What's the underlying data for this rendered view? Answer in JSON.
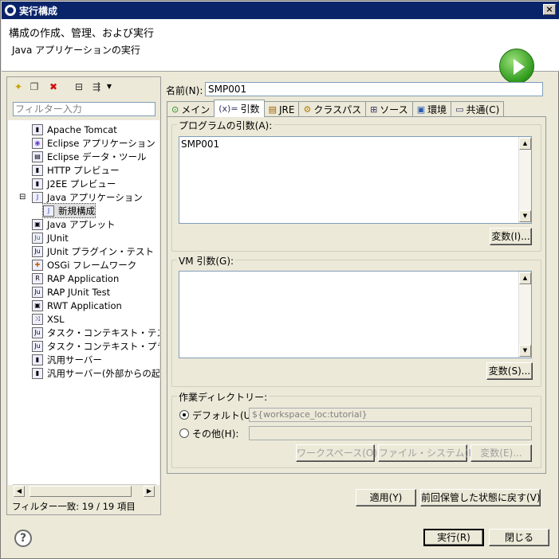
{
  "window": {
    "title": "実行構成",
    "close_glyph": "×"
  },
  "header": {
    "title": "構成の作成、管理、および実行",
    "subtitle": "Java アプリケーションの実行"
  },
  "left": {
    "filter_placeholder": "フィルター入力",
    "tree": [
      {
        "label": "Apache Tomcat",
        "icon": "tomcat-icon"
      },
      {
        "label": "Eclipse アプリケーション",
        "icon": "eclipse-icon"
      },
      {
        "label": "Eclipse データ・ツール",
        "icon": "database-icon"
      },
      {
        "label": "HTTP プレビュー",
        "icon": "server-icon"
      },
      {
        "label": "J2EE プレビュー",
        "icon": "server-icon"
      },
      {
        "label": "Java アプリケーション",
        "icon": "java-app-icon"
      },
      {
        "label": "新規構成",
        "icon": "java-app-icon"
      },
      {
        "label": "Java アプレット",
        "icon": "applet-icon"
      },
      {
        "label": "JUnit",
        "icon": "junit-icon"
      },
      {
        "label": "JUnit プラグイン・テスト",
        "icon": "junit-plugin-icon"
      },
      {
        "label": "OSGi フレームワーク",
        "icon": "osgi-icon"
      },
      {
        "label": "RAP Application",
        "icon": "rap-icon"
      },
      {
        "label": "RAP JUnit Test",
        "icon": "rap-junit-icon"
      },
      {
        "label": "RWT Application",
        "icon": "rwt-icon"
      },
      {
        "label": "XSL",
        "icon": "xsl-icon"
      },
      {
        "label": "タスク・コンテキスト・テスト",
        "icon": "task-test-icon"
      },
      {
        "label": "タスク・コンテキスト・プラグイン・",
        "icon": "task-plugin-icon"
      },
      {
        "label": "汎用サーバー",
        "icon": "server-icon"
      },
      {
        "label": "汎用サーバー(外部からの起動",
        "icon": "server-icon"
      }
    ],
    "status": "フィルター一致: 19 / 19 項目"
  },
  "right": {
    "name_label": "名前(N):",
    "name_value": "SMP001",
    "tabs": [
      "メイン",
      "引数",
      "JRE",
      "クラスパス",
      "ソース",
      "環境",
      "共通(C)"
    ],
    "tab_glyphs": [
      "⊙",
      "(x)=",
      "▤",
      "⚙",
      "⊞",
      "▣",
      "▭"
    ],
    "program_args_label": "プログラムの引数(A):",
    "program_args_value": "SMP001",
    "variables1": "変数(I)...",
    "vm_args_label": "VM 引数(G):",
    "vm_args_value": "",
    "variables2": "変数(S)...",
    "workdir_label": "作業ディレクトリー:",
    "default_label": "デフォルト(U):",
    "default_value": "${workspace_loc:tutorial}",
    "other_label": "その他(H):",
    "other_value": "",
    "workspace_btn": "ワークスペース(O)...",
    "filesystem_btn": "ファイル・システム(F)...",
    "variables3": "変数(E)...",
    "apply": "適用(Y)",
    "revert": "前回保管した状態に戻す(V)"
  },
  "footer": {
    "run": "実行(R)",
    "close": "閉じる",
    "help": "?"
  }
}
